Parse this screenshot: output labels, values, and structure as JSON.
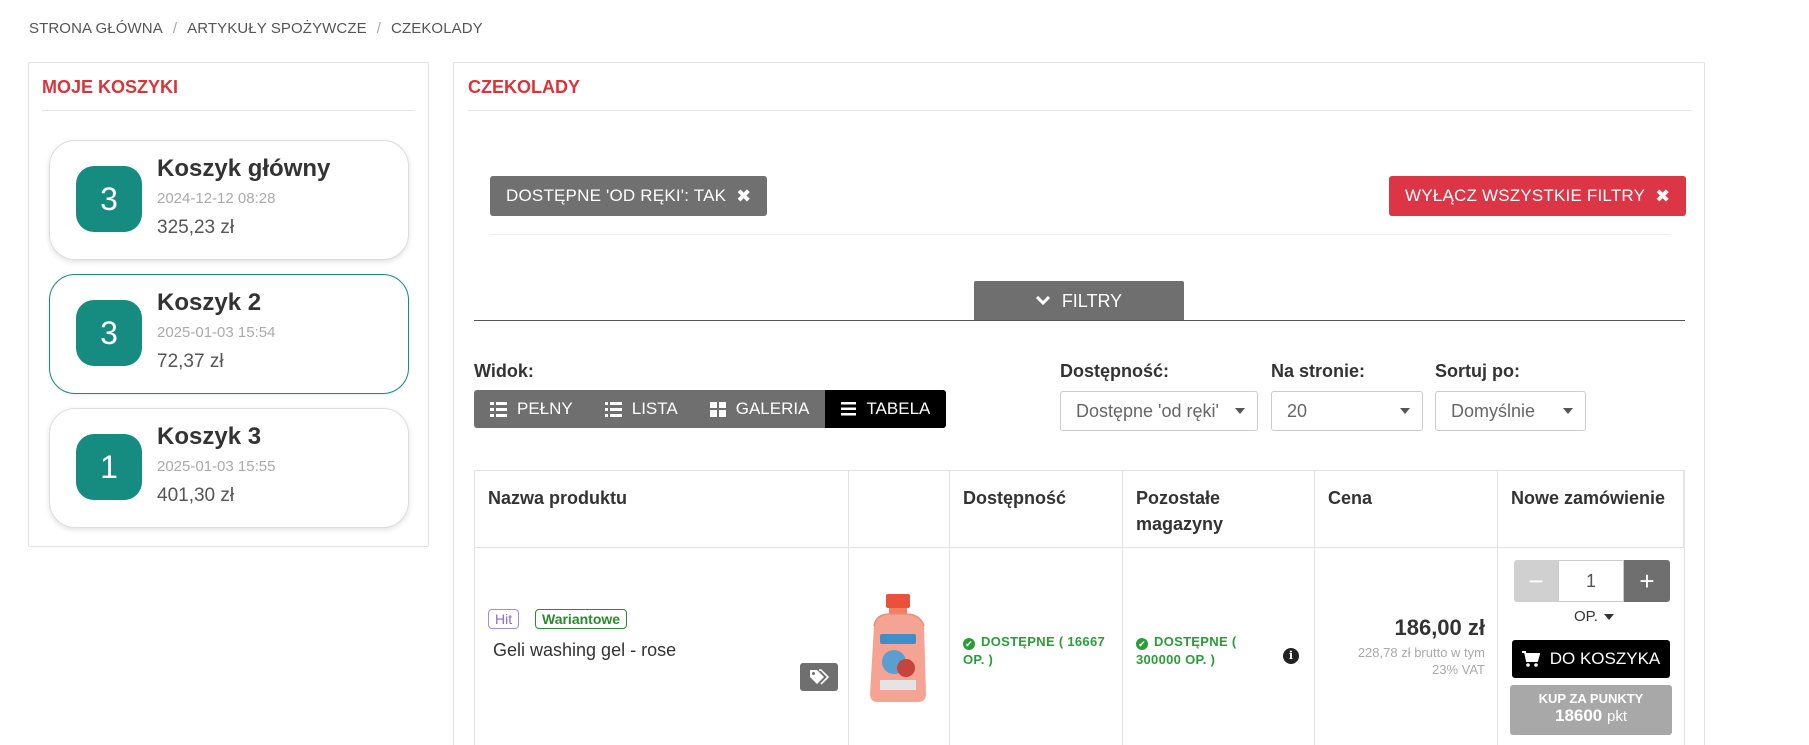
{
  "breadcrumb": {
    "items": [
      "STRONA GŁÓWNA",
      "ARTYKUŁY SPOŻYWCZE",
      "CZEKOLADY"
    ],
    "separator": "/"
  },
  "sidebar": {
    "title": "MOJE KOSZYKI",
    "carts": [
      {
        "count": "3",
        "name": "Koszyk główny",
        "date": "2024-12-12 08:28",
        "total": "325,23 zł"
      },
      {
        "count": "3",
        "name": "Koszyk 2",
        "date": "2025-01-03 15:54",
        "total": "72,37 zł"
      },
      {
        "count": "1",
        "name": "Koszyk 3",
        "date": "2025-01-03 15:55",
        "total": "401,30 zł"
      }
    ]
  },
  "main": {
    "title": "CZEKOLADY",
    "active_filter": "DOSTĘPNE 'OD RĘKI':  TAK",
    "clear_filters": "WYŁĄCZ WSZYSTKIE FILTRY",
    "filters_tab": "FILTRY",
    "view": {
      "label": "Widok:",
      "options": [
        "PEŁNY",
        "LISTA",
        "GALERIA",
        "TABELA"
      ],
      "selected": "TABELA"
    },
    "availability": {
      "label": "Dostępność:",
      "value": "Dostępne 'od ręki'"
    },
    "per_page": {
      "label": "Na stronie:",
      "value": "20"
    },
    "sort": {
      "label": "Sortuj po:",
      "value": "Domyślnie"
    }
  },
  "table": {
    "headers": [
      "Nazwa produktu",
      "",
      "Dostępność",
      "Pozostałe magazyny",
      "Cena",
      "Nowe zamówienie"
    ],
    "rows": [
      {
        "tags": [
          "Hit",
          "Wariantowe"
        ],
        "name": "Geli washing gel - rose",
        "availability": "DOSTĘPNE ( 16667 OP. )",
        "other_warehouses": "DOSTĘPNE ( 300000 OP. )",
        "price": "186,00 zł",
        "price_gross": "228,78 zł brutto w tym 23% VAT",
        "quantity": "1",
        "unit": "OP.",
        "add_to_cart": "DO KOSZYKA",
        "buy_points_label": "KUP ZA PUNKTY",
        "points": "18600",
        "points_unit": "pkt"
      }
    ]
  },
  "colors": {
    "accent_red": "#d9343a",
    "teal": "#168b80",
    "green": "#2c9c3a"
  }
}
